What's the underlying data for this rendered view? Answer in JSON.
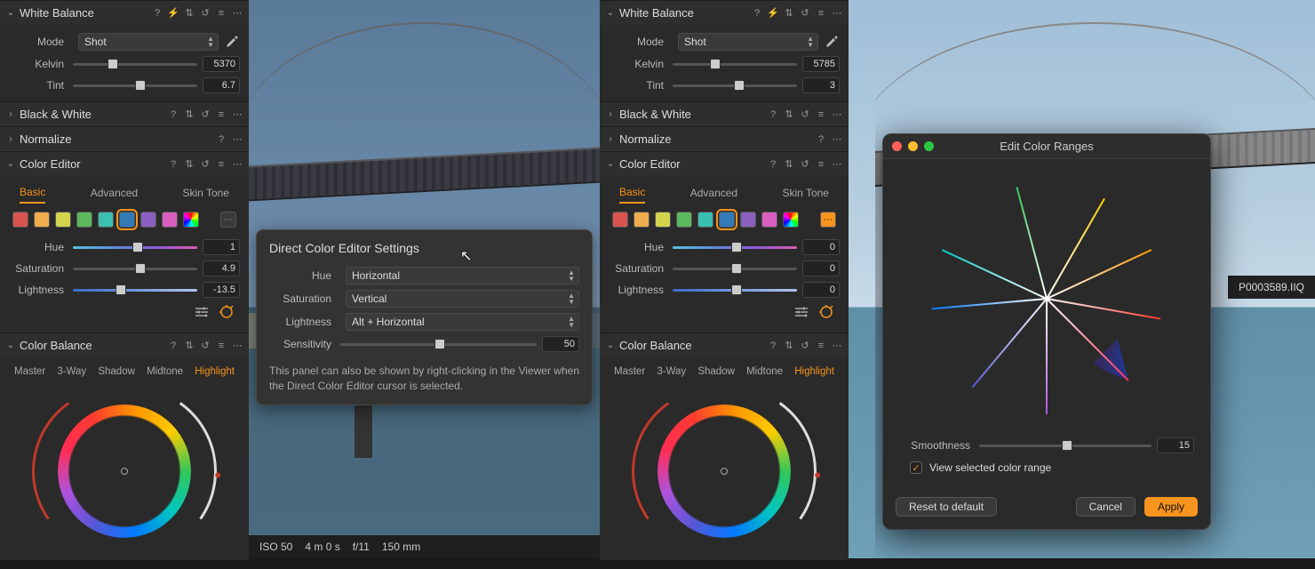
{
  "left": {
    "wb": {
      "title": "White Balance",
      "mode_label": "Mode",
      "mode_value": "Shot",
      "kelvin_label": "Kelvin",
      "kelvin_value": "5370",
      "tint_label": "Tint",
      "tint_value": "6.7"
    },
    "bw": {
      "title": "Black & White"
    },
    "normalize": {
      "title": "Normalize"
    },
    "ce": {
      "title": "Color Editor",
      "tabs": {
        "basic": "Basic",
        "advanced": "Advanced",
        "skin": "Skin Tone"
      },
      "swatches": [
        "#d9534f",
        "#f0ad4e",
        "#d4d44e",
        "#5cb85c",
        "#3bbfb0",
        "#337ab7",
        "#8a5fbf",
        "#d95fbf"
      ],
      "selected_swatch_index": 5,
      "hue_label": "Hue",
      "hue_value": "1",
      "sat_label": "Saturation",
      "sat_value": "4.9",
      "light_label": "Lightness",
      "light_value": "-13.5"
    },
    "cb": {
      "title": "Color Balance",
      "tabs": {
        "master": "Master",
        "threeway": "3-Way",
        "shadow": "Shadow",
        "midtone": "Midtone",
        "highlight": "Highlight"
      }
    }
  },
  "right": {
    "wb": {
      "title": "White Balance",
      "mode_label": "Mode",
      "mode_value": "Shot",
      "kelvin_label": "Kelvin",
      "kelvin_value": "5785",
      "tint_label": "Tint",
      "tint_value": "3"
    },
    "bw": {
      "title": "Black & White"
    },
    "normalize": {
      "title": "Normalize"
    },
    "ce": {
      "title": "Color Editor",
      "tabs": {
        "basic": "Basic",
        "advanced": "Advanced",
        "skin": "Skin Tone"
      },
      "swatches": [
        "#d9534f",
        "#f0ad4e",
        "#d4d44e",
        "#5cb85c",
        "#3bbfb0",
        "#337ab7",
        "#8a5fbf",
        "#d95fbf"
      ],
      "selected_swatch_index": 5,
      "hue_label": "Hue",
      "hue_value": "0",
      "sat_label": "Saturation",
      "sat_value": "0",
      "light_label": "Lightness",
      "light_value": "0"
    },
    "cb": {
      "title": "Color Balance",
      "tabs": {
        "master": "Master",
        "threeway": "3-Way",
        "shadow": "Shadow",
        "midtone": "Midtone",
        "highlight": "Highlight"
      }
    }
  },
  "popover": {
    "title": "Direct Color Editor Settings",
    "hue_label": "Hue",
    "hue_value": "Horizontal",
    "sat_label": "Saturation",
    "sat_value": "Vertical",
    "light_label": "Lightness",
    "light_value": "Alt + Horizontal",
    "sens_label": "Sensitivity",
    "sens_value": "50",
    "hint": "This panel can also be shown by right-clicking in the Viewer when the Direct Color Editor cursor is selected."
  },
  "viewer": {
    "iso": "ISO 50",
    "shutter": "4 m 0 s",
    "aperture": "f/11",
    "focal": "150 mm",
    "filename": "P0003589.IIQ"
  },
  "modal": {
    "title": "Edit Color Ranges",
    "smooth_label": "Smoothness",
    "smooth_value": "15",
    "view_label": "View selected color range",
    "reset": "Reset to default",
    "cancel": "Cancel",
    "apply": "Apply"
  }
}
